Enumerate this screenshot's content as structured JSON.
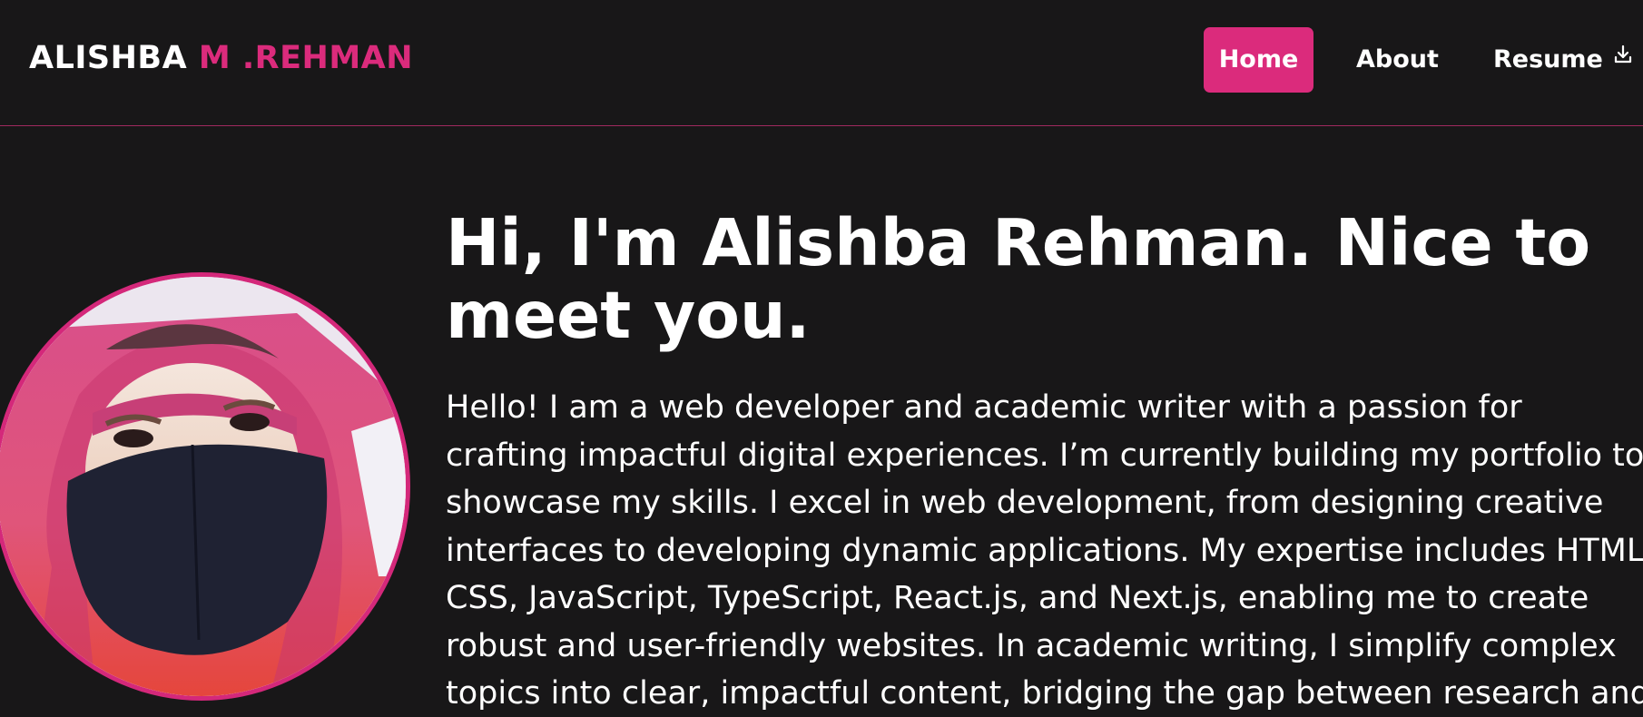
{
  "brand": {
    "first": "ALISHBA",
    "last": "M .REHMAN"
  },
  "nav": {
    "home": "Home",
    "about": "About",
    "resume": "Resume",
    "resume_icon": "download-icon"
  },
  "colors": {
    "accent": "#db2b7c",
    "background": "#181718",
    "text": "#ffffff"
  },
  "hero": {
    "title_line1": "Hi, I'm Alishba Rehman. Nice to",
    "title_line2": "meet you.",
    "paragraph_lines": [
      "Hello! I am a web developer and academic writer with a passion for",
      "crafting impactful digital experiences. I’m currently building my portfolio to",
      "showcase my skills. I excel in web development, from designing creative",
      "interfaces to developing dynamic applications. My expertise includes HTML,",
      "CSS, JavaScript, TypeScript, React.js, and Next.js, enabling me to create",
      "robust and user-friendly websites. In academic writing, I simplify complex",
      "topics into clear, impactful content, bridging the gap between research and"
    ]
  }
}
